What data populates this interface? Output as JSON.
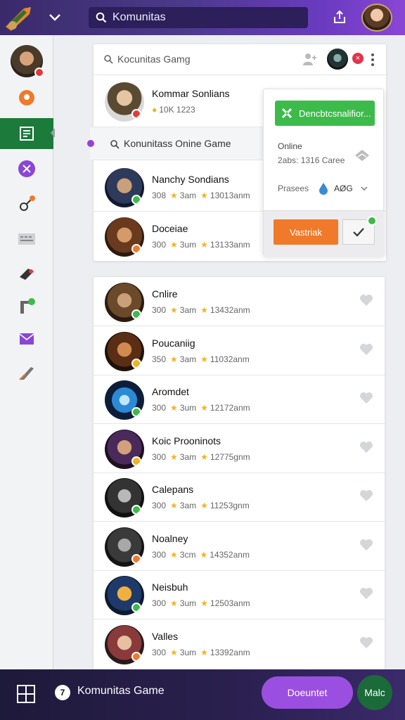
{
  "header": {
    "search_text": "Komunitas"
  },
  "sidebar": {
    "items": [
      {
        "icon": "location-pin-icon",
        "color": "#f07a2a"
      },
      {
        "icon": "newspaper-icon",
        "color": "#ffffff",
        "active": true
      },
      {
        "icon": "tools-icon",
        "color": "#8a46d6"
      },
      {
        "icon": "connection-icon",
        "color": "#f07a2a"
      },
      {
        "icon": "keyboard-icon",
        "color": "#777777"
      },
      {
        "icon": "camera-icon",
        "color": "#333333"
      },
      {
        "icon": "layout-icon",
        "color": "#555555"
      },
      {
        "icon": "mail-icon",
        "color": "#8a46d6"
      },
      {
        "icon": "feather-icon",
        "color": "#555555"
      }
    ]
  },
  "top_card": {
    "search_text": "Kocunitas Gamg",
    "badge_text": "×",
    "rows": [
      {
        "name": "Kommar Sonlians",
        "meta": "10K 1223"
      },
      {
        "name": "Nanchy Sondians",
        "meta_a": "308",
        "meta_b": "3am",
        "meta_c": "13013anm"
      },
      {
        "name": "Doceiae",
        "meta_a": "300",
        "meta_b": "3um",
        "meta_c": "13133anm"
      }
    ],
    "inner_search": "Konunitass Onine Game"
  },
  "popover": {
    "primary_button": "Dencbtcsnalifior...",
    "status": "Online",
    "status_sub": "2abs: 1316 Caree",
    "prases_label": "Prasees",
    "prases_value": "AØG",
    "orange_button": "Vastriak"
  },
  "list": [
    {
      "name": "Cnlire",
      "a": "300",
      "b": "3am",
      "c": "13432anm",
      "tick": "#3cbb4a"
    },
    {
      "name": "Poucaniig",
      "a": "350",
      "b": "3am",
      "c": "11032anm",
      "tick": "#f2b31c"
    },
    {
      "name": "Aromdet",
      "a": "300",
      "b": "3um",
      "c": "12172anm",
      "tick": "#3cbb4a"
    },
    {
      "name": "Koic Prooninots",
      "a": "300",
      "b": "3am",
      "c": "12775gnm",
      "tick": "#f2b31c"
    },
    {
      "name": "Calepans",
      "a": "300",
      "b": "3am",
      "c": "11253gnm",
      "tick": "#3cbb4a"
    },
    {
      "name": "Noalney",
      "a": "300",
      "b": "3cm",
      "c": "14352anm",
      "tick": "#f07a2a"
    },
    {
      "name": "Neisbuh",
      "a": "300",
      "b": "3um",
      "c": "12503anm",
      "tick": "#3cbb4a"
    },
    {
      "name": "Valles",
      "a": "300",
      "b": "3um",
      "c": "13392anm",
      "tick": "#f07a2a"
    }
  ],
  "bottom": {
    "number": "7",
    "title": "Komunitas Game",
    "purple_button": "Doeuntet",
    "green_button": "Malc"
  }
}
